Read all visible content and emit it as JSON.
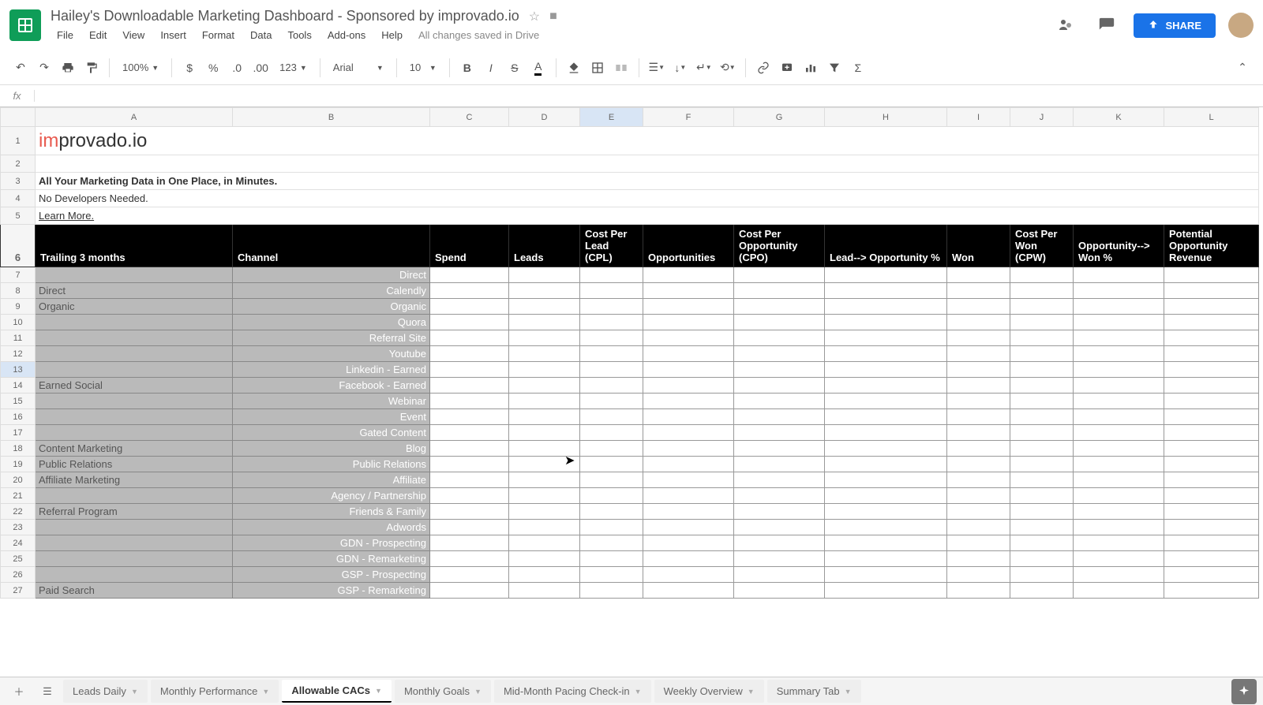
{
  "doc": {
    "title": "Hailey's Downloadable Marketing Dashboard - Sponsored by improvado.io",
    "save_status": "All changes saved in Drive"
  },
  "menus": [
    "File",
    "Edit",
    "View",
    "Insert",
    "Format",
    "Data",
    "Tools",
    "Add-ons",
    "Help"
  ],
  "share_label": "SHARE",
  "toolbar": {
    "zoom": "100%",
    "format_num": "123",
    "font": "Arial",
    "font_size": "10"
  },
  "formula_bar": {
    "fx": "fx",
    "value": ""
  },
  "columns": [
    "A",
    "B",
    "C",
    "D",
    "E",
    "F",
    "G",
    "H",
    "I",
    "J",
    "K",
    "L"
  ],
  "selected_col": "E",
  "selected_row": 13,
  "logo": {
    "prefix": "im",
    "rest": "provado.io"
  },
  "promo": {
    "line1": "All Your Marketing Data in One Place, in Minutes.",
    "line2": "No Developers Needed.",
    "link": "Learn More."
  },
  "headers": {
    "colA": "Trailing 3 months",
    "colB": "Channel",
    "colC": "Spend",
    "colD": "Leads",
    "colE": "Cost Per Lead (CPL)",
    "colF": "Opportunities",
    "colG": "Cost Per Opportunity (CPO)",
    "colH": "Lead--> Opportunity %",
    "colI": "Won",
    "colJ": "Cost Per Won (CPW)",
    "colK": "Opportunity--> Won %",
    "colL": "Potential Opportunity Revenue"
  },
  "rows": [
    {
      "num": 7,
      "cat": "",
      "chan": "Direct"
    },
    {
      "num": 8,
      "cat": "Direct",
      "chan": "Calendly"
    },
    {
      "num": 9,
      "cat": "Organic",
      "chan": "Organic"
    },
    {
      "num": 10,
      "cat": "",
      "chan": "Quora"
    },
    {
      "num": 11,
      "cat": "",
      "chan": "Referral Site"
    },
    {
      "num": 12,
      "cat": "",
      "chan": "Youtube"
    },
    {
      "num": 13,
      "cat": "",
      "chan": "Linkedin - Earned"
    },
    {
      "num": 14,
      "cat": "Earned Social",
      "chan": "Facebook - Earned"
    },
    {
      "num": 15,
      "cat": "",
      "chan": "Webinar"
    },
    {
      "num": 16,
      "cat": "",
      "chan": "Event"
    },
    {
      "num": 17,
      "cat": "",
      "chan": "Gated Content"
    },
    {
      "num": 18,
      "cat": "Content Marketing",
      "chan": "Blog"
    },
    {
      "num": 19,
      "cat": "Public Relations",
      "chan": "Public Relations"
    },
    {
      "num": 20,
      "cat": "Affiliate Marketing",
      "chan": "Affiliate"
    },
    {
      "num": 21,
      "cat": "",
      "chan": "Agency / Partnership"
    },
    {
      "num": 22,
      "cat": "Referral Program",
      "chan": "Friends & Family"
    },
    {
      "num": 23,
      "cat": "",
      "chan": "Adwords"
    },
    {
      "num": 24,
      "cat": "",
      "chan": "GDN - Prospecting"
    },
    {
      "num": 25,
      "cat": "",
      "chan": "GDN - Remarketing"
    },
    {
      "num": 26,
      "cat": "",
      "chan": "GSP - Prospecting"
    },
    {
      "num": 27,
      "cat": "Paid Search",
      "chan": "GSP - Remarketing"
    }
  ],
  "tabs": [
    {
      "label": "Leads Daily",
      "active": false
    },
    {
      "label": "Monthly Performance",
      "active": false
    },
    {
      "label": "Allowable CACs",
      "active": true
    },
    {
      "label": "Monthly Goals",
      "active": false
    },
    {
      "label": "Mid-Month Pacing Check-in",
      "active": false
    },
    {
      "label": "Weekly Overview",
      "active": false
    },
    {
      "label": "Summary Tab",
      "active": false
    }
  ]
}
